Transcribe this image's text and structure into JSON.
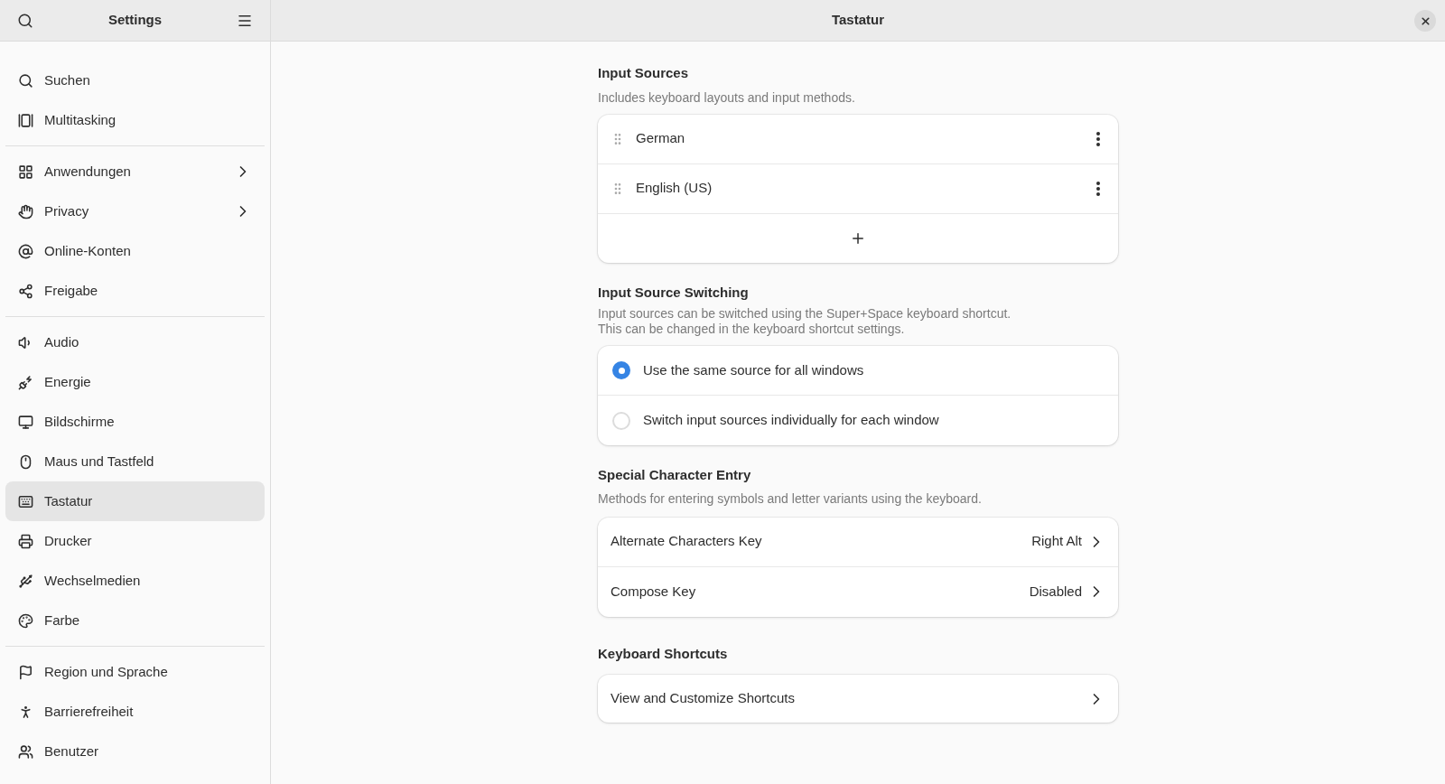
{
  "sidebar": {
    "title": "Settings",
    "groups": [
      [
        {
          "label": "Suchen",
          "selected": false,
          "submenu": false
        },
        {
          "label": "Multitasking",
          "selected": false,
          "submenu": false
        }
      ],
      [
        {
          "label": "Anwendungen",
          "selected": false,
          "submenu": true
        },
        {
          "label": "Privacy",
          "selected": false,
          "submenu": true
        },
        {
          "label": "Online-Konten",
          "selected": false,
          "submenu": false
        },
        {
          "label": "Freigabe",
          "selected": false,
          "submenu": false
        }
      ],
      [
        {
          "label": "Audio",
          "selected": false,
          "submenu": false
        },
        {
          "label": "Energie",
          "selected": false,
          "submenu": false
        },
        {
          "label": "Bildschirme",
          "selected": false,
          "submenu": false
        },
        {
          "label": "Maus und Tastfeld",
          "selected": false,
          "submenu": false
        },
        {
          "label": "Tastatur",
          "selected": true,
          "submenu": false
        },
        {
          "label": "Drucker",
          "selected": false,
          "submenu": false
        },
        {
          "label": "Wechselmedien",
          "selected": false,
          "submenu": false
        },
        {
          "label": "Farbe",
          "selected": false,
          "submenu": false
        }
      ],
      [
        {
          "label": "Region und Sprache",
          "selected": false,
          "submenu": false
        },
        {
          "label": "Barrierefreiheit",
          "selected": false,
          "submenu": false
        },
        {
          "label": "Benutzer",
          "selected": false,
          "submenu": false
        }
      ]
    ]
  },
  "window": {
    "title": "Tastatur"
  },
  "input_sources": {
    "heading": "Input Sources",
    "description": "Includes keyboard layouts and input methods.",
    "sources": [
      "German",
      "English (US)"
    ]
  },
  "switching": {
    "heading": "Input Source Switching",
    "description": [
      "Input sources can be switched using the Super+Space keyboard shortcut.",
      "This can be changed in the keyboard shortcut settings."
    ],
    "options": [
      {
        "label": "Use the same source for all windows",
        "selected": true
      },
      {
        "label": "Switch input sources individually for each window",
        "selected": false
      }
    ]
  },
  "special": {
    "heading": "Special Character Entry",
    "description": "Methods for entering symbols and letter variants using the keyboard.",
    "rows": [
      {
        "label": "Alternate Characters Key",
        "value": "Right Alt"
      },
      {
        "label": "Compose Key",
        "value": "Disabled"
      }
    ]
  },
  "shortcuts": {
    "heading": "Keyboard Shortcuts",
    "rows": [
      {
        "label": "View and Customize Shortcuts"
      }
    ]
  }
}
